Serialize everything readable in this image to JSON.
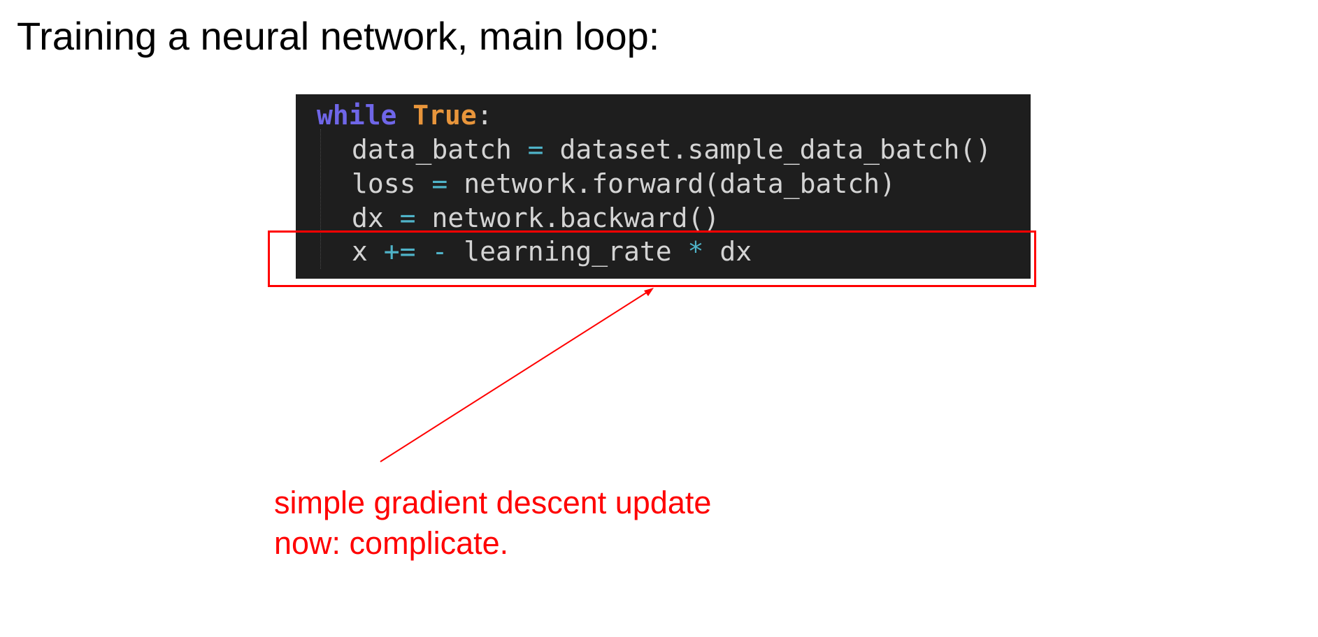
{
  "slide": {
    "title": "Training a neural network, main loop:"
  },
  "code": {
    "line1": {
      "keyword": "while",
      "const": "True",
      "colon": ":"
    },
    "line2": {
      "lhs": "data_batch",
      "op": "=",
      "rhs": "dataset.sample_data_batch()"
    },
    "line3": {
      "lhs": "loss",
      "op": "=",
      "rhs": "network.forward(data_batch)"
    },
    "line4": {
      "lhs": "dx",
      "op": "=",
      "rhs": "network.backward()"
    },
    "line5": {
      "lhs": "x",
      "op1": "+=",
      "op2": "-",
      "mid": "learning_rate",
      "op3": "*",
      "rhs": "dx"
    }
  },
  "annotation": {
    "line1": "simple gradient descent update",
    "line2": "now: complicate.",
    "color": "#ff0000"
  },
  "colors": {
    "code_background": "#1e1e1e",
    "keyword": "#6f66e8",
    "constant": "#e8953b",
    "operator": "#4fb3c8",
    "code_text": "#d4d4d4"
  }
}
